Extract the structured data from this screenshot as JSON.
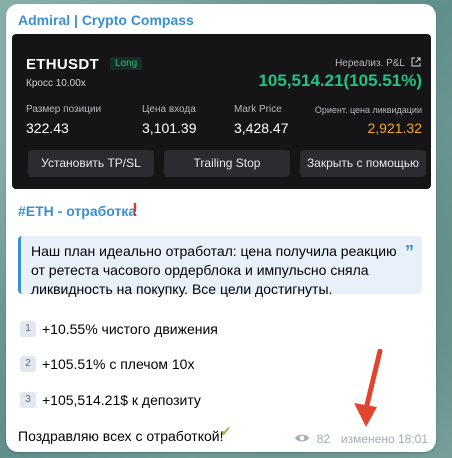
{
  "channel": {
    "title": "Admiral | Crypto Compass"
  },
  "card": {
    "pair": "ETHUSDT",
    "side": "Long",
    "margin": "Кросс 10.00x",
    "pnl_label": "Нереализ. P&L",
    "pnl_value": "105,514.21(105.51%)",
    "stats": [
      {
        "label": "Размер позиции",
        "value": "322.43"
      },
      {
        "label": "Цена входа",
        "value": "3,101.39"
      },
      {
        "label": "Mark Price",
        "value": "3,428.47"
      },
      {
        "label": "Ориент. цена ликвидации",
        "value": "2,921.32"
      }
    ],
    "buttons": [
      "Установить TP/SL",
      "Trailing Stop",
      "Закрыть с помощью"
    ],
    "colors": {
      "profit": "#21c284",
      "liquidation": "#f5a623",
      "background": "#151518"
    }
  },
  "message": {
    "hashtag": "#ETH - отработка",
    "exclaim_icon": "red-exclamation-icon",
    "quote": "Наш план идеально отработал: цена получила реакцию от ретеста часового ордерблока и импульсно сняла ликвидность на покупку. Все цели достигнуты.",
    "list": [
      {
        "num": "1",
        "text": "+10.55% чистого движения"
      },
      {
        "num": "2",
        "text": "+105.51% с плечом 10x"
      },
      {
        "num": "3",
        "text": "+105,514.21$ к депозиту"
      }
    ],
    "closing": "Поздравляю всех с отработкой!",
    "views": "82",
    "edited": "изменено 18:01"
  }
}
